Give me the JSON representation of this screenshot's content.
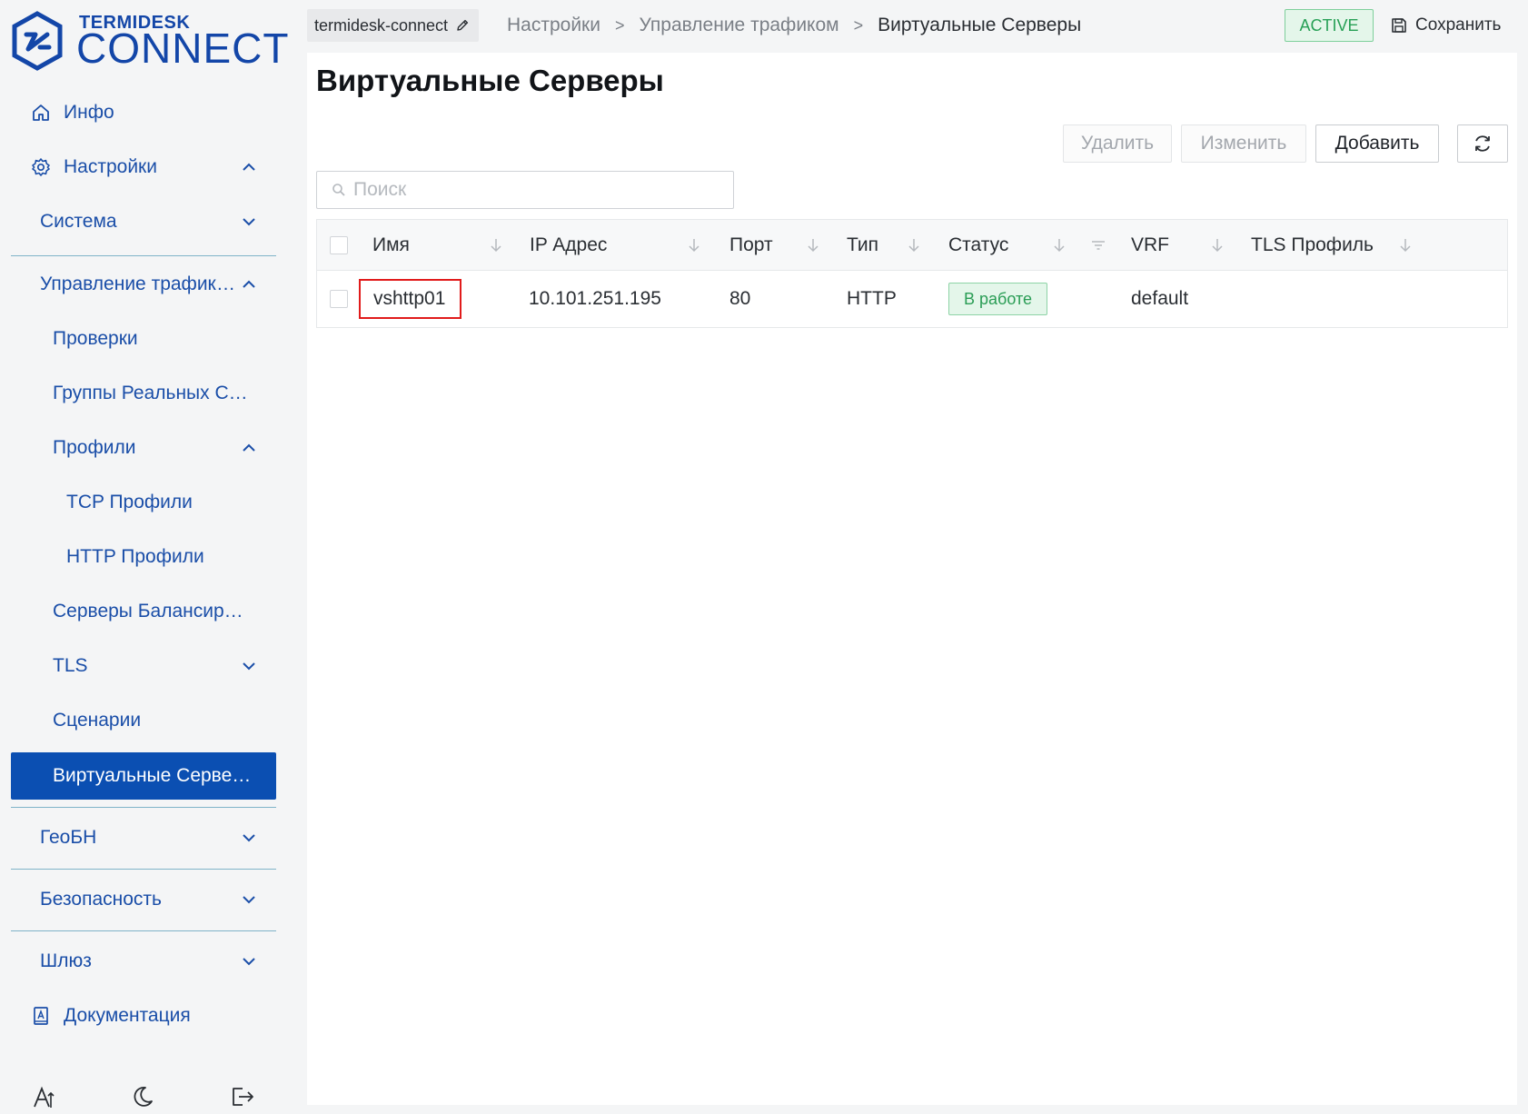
{
  "logo": {
    "top": "TERMIDESK",
    "main": "CONNECT"
  },
  "sidebar": {
    "items": [
      {
        "label": "Инфо",
        "icon": "home-icon"
      },
      {
        "label": "Настройки",
        "icon": "gear-icon",
        "expanded": true
      },
      {
        "label": "Система",
        "expanded": false
      },
      {
        "label": "Управление трафиком",
        "expanded": true
      },
      {
        "label": "Проверки"
      },
      {
        "label": "Группы Реальных Серверов"
      },
      {
        "label": "Профили",
        "expanded": true
      },
      {
        "label": "TCP Профили"
      },
      {
        "label": "HTTP Профили"
      },
      {
        "label": "Серверы Балансировки"
      },
      {
        "label": "TLS",
        "expanded": false
      },
      {
        "label": "Сценарии"
      },
      {
        "label": "Виртуальные Серверы",
        "active": true
      },
      {
        "label": "ГеоБН",
        "expanded": false
      },
      {
        "label": "Безопасность",
        "expanded": false
      },
      {
        "label": "Шлюз",
        "expanded": false
      },
      {
        "label": "Документация",
        "icon": "book-icon"
      }
    ],
    "footer_icons": [
      "font-size-icon",
      "moon-icon",
      "logout-icon"
    ]
  },
  "topbar": {
    "project": "termidesk-connect",
    "breadcrumbs": [
      "Настройки",
      "Управление трафиком",
      "Виртуальные Серверы"
    ],
    "separator": ">",
    "status": "ACTIVE",
    "save_label": "Сохранить"
  },
  "main": {
    "title": "Виртуальные Серверы",
    "buttons": {
      "delete": "Удалить",
      "edit": "Изменить",
      "add": "Добавить"
    },
    "search": {
      "placeholder": "Поиск",
      "value": ""
    },
    "table": {
      "columns": [
        "Имя",
        "IP Адрес",
        "Порт",
        "Тип",
        "Статус",
        "VRF",
        "TLS Профиль"
      ],
      "rows": [
        {
          "name": "vshttp01",
          "ip": "10.101.251.195",
          "port": "80",
          "type": "HTTP",
          "status": "В работе",
          "vrf": "default",
          "tls_profile": ""
        }
      ]
    }
  },
  "colors": {
    "brand": "#1346a8",
    "nav_text": "#1a4ea8",
    "nav_active_bg": "#0b4fb2",
    "status_green": "#27a056",
    "highlight_red": "#e11b1b"
  }
}
